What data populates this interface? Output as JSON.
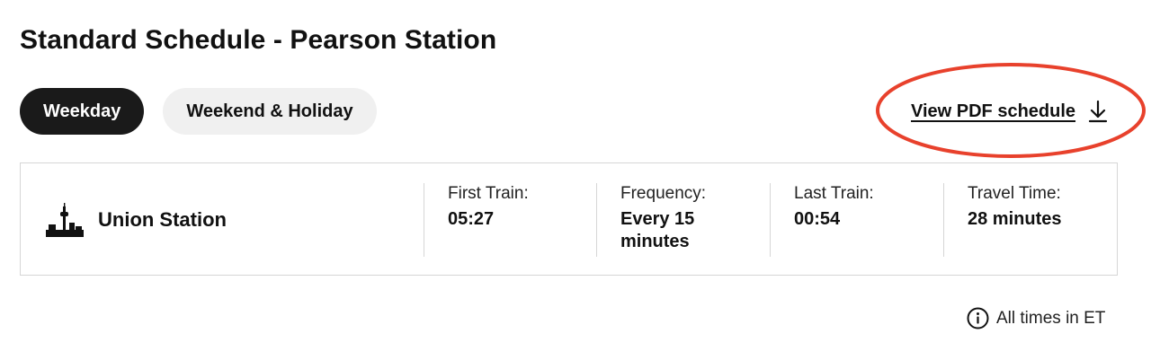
{
  "page": {
    "title": "Standard Schedule - Pearson Station"
  },
  "tabs": [
    {
      "label": "Weekday",
      "active": true
    },
    {
      "label": "Weekend & Holiday",
      "active": false
    }
  ],
  "pdf_link": {
    "label": "View PDF schedule",
    "icon": "download-icon",
    "highlight_color": "#e8412c"
  },
  "schedule": {
    "station": {
      "name": "Union Station",
      "icon": "city-skyline-icon"
    },
    "columns": [
      {
        "label": "First Train:",
        "value": "05:27"
      },
      {
        "label": "Frequency:",
        "value": "Every 15 minutes"
      },
      {
        "label": "Last Train:",
        "value": "00:54"
      },
      {
        "label": "Travel Time:",
        "value": "28 minutes"
      }
    ]
  },
  "footnote": {
    "icon": "info-icon",
    "text": "All times in ET"
  },
  "colors": {
    "active_tab_bg": "#1a1a1a",
    "inactive_tab_bg": "#f0f0f0",
    "border": "#d6d6d6",
    "annotation_red": "#e8412c"
  }
}
